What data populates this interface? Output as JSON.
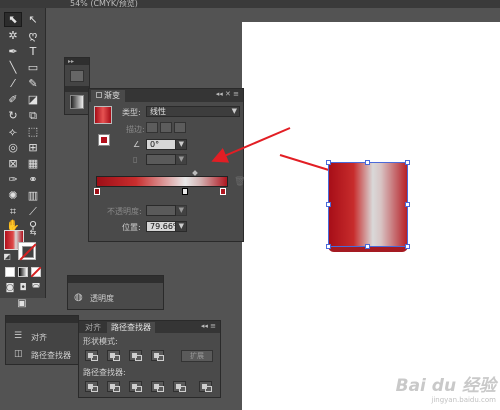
{
  "window": {
    "title": "54% (CMYK/预览)"
  },
  "gradient_panel": {
    "tab_label": "渐变",
    "type_label": "类型:",
    "type_value": "线性",
    "stroke_label": "描边:",
    "angle_value": "0°",
    "aspect_label": "",
    "opacity_label": "不透明度:",
    "opacity_value": "",
    "location_label": "位置:",
    "location_value": "79.66%",
    "stops": [
      {
        "location": 0,
        "color": "#9e0f17"
      },
      {
        "location": 68,
        "color": "#e8e8e8"
      },
      {
        "location": 100,
        "color": "#b01620"
      }
    ]
  },
  "transparency_panel": {
    "label": "透明度"
  },
  "align_dock": {
    "items": [
      "对齐",
      "路径查找器"
    ]
  },
  "pathfinder_panel": {
    "tabs": [
      "对齐",
      "路径查找器"
    ],
    "shape_modes_label": "形状模式:",
    "expand_label": "扩展",
    "pathfinders_label": "路径查找器:"
  },
  "watermark": {
    "brand": "Bai du 经验",
    "url": "jingyan.baidu.com"
  },
  "colors": {
    "accent_red": "#c8161d",
    "panel_bg": "#4a4a4a",
    "selection": "#4a6ad9"
  }
}
